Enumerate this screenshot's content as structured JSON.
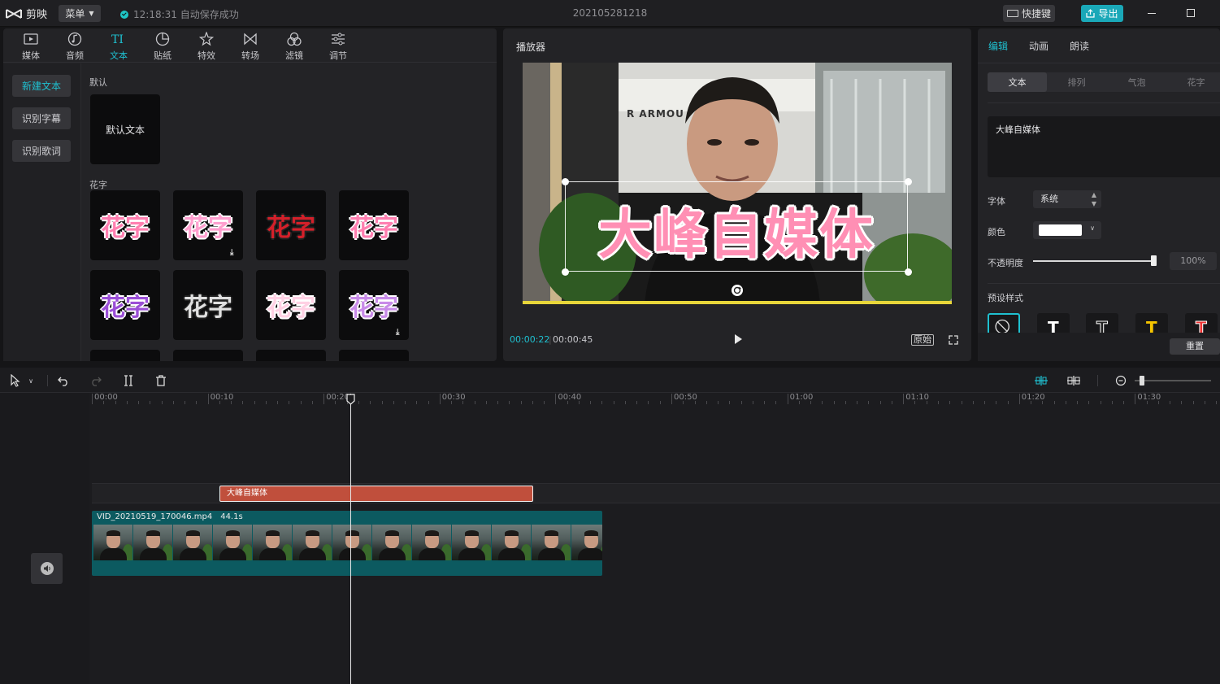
{
  "app": {
    "name": "剪映",
    "menu_label": "菜单",
    "save_status": "12:18:31 自动保存成功",
    "project_name": "202105281218",
    "shortcut_label": "快捷键",
    "export_label": "导出"
  },
  "library": {
    "tabs": [
      {
        "label": "媒体",
        "icon": "media-icon"
      },
      {
        "label": "音频",
        "icon": "audio-icon"
      },
      {
        "label": "文本",
        "icon": "text-icon"
      },
      {
        "label": "贴纸",
        "icon": "sticker-icon"
      },
      {
        "label": "特效",
        "icon": "effects-icon"
      },
      {
        "label": "转场",
        "icon": "transition-icon"
      },
      {
        "label": "滤镜",
        "icon": "filter-icon"
      },
      {
        "label": "调节",
        "icon": "adjust-icon"
      }
    ],
    "active_tab": "文本",
    "side_buttons": [
      "新建文本",
      "识别字幕",
      "识别歌词"
    ],
    "section_default": "默认",
    "default_card_label": "默认文本",
    "section_fancy": "花字",
    "fancy_text": "花字",
    "fancy_colors": [
      "#ff7fb0",
      "#ff9fcf",
      "#d4202a",
      "#ff7fb0",
      "#9b4fd6",
      "#e0e0e0",
      "#ffd1e4",
      "#c88be8"
    ],
    "accent_color": "#1fc0d0"
  },
  "player": {
    "title": "播放器",
    "overlay_text": "大峰自媒体",
    "store_sign": "R ARMOU",
    "current_time": "00:00:22",
    "total_time": "00:00:45",
    "ratio_label": "原始"
  },
  "inspector": {
    "tabs": [
      "编辑",
      "动画",
      "朗读"
    ],
    "sub_tabs": [
      "文本",
      "排列",
      "气泡",
      "花字"
    ],
    "text_content": "大峰自媒体",
    "font_label": "字体",
    "font_value": "系统",
    "color_label": "颜色",
    "color_value": "#ffffff",
    "opacity_label": "不透明度",
    "opacity_value": "100%",
    "opacity_fraction": 1.0,
    "preset_label": "预设样式",
    "reset_label": "重置"
  },
  "timeline": {
    "ruler_labels": [
      "00:00",
      "00:10",
      "00:20",
      "00:30",
      "00:40",
      "00:50",
      "01:00",
      "01:10",
      "01:20",
      "01:30"
    ],
    "text_clip_label": "大峰自媒体",
    "video_clip_name": "VID_20210519_170046.mp4",
    "video_clip_duration": "44.1s"
  }
}
